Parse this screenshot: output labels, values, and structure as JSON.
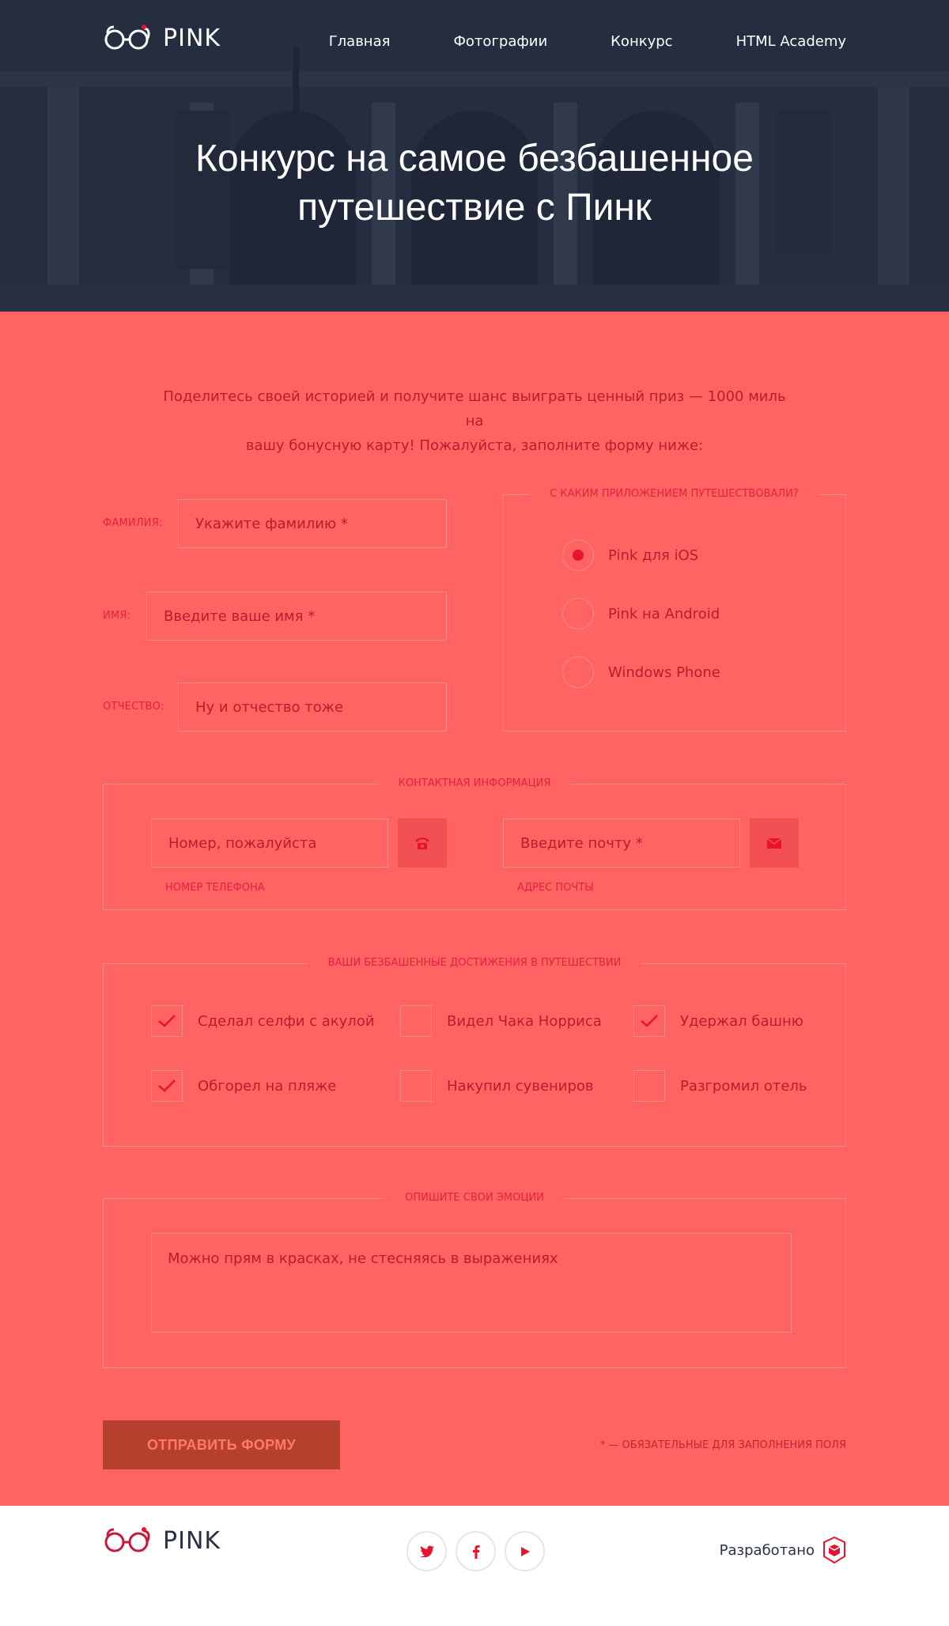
{
  "header": {
    "logo_text": "PINK",
    "nav": [
      {
        "label": "Главная"
      },
      {
        "label": "Фотографии"
      },
      {
        "label": "Конкурс"
      },
      {
        "label": "HTML Academy"
      }
    ],
    "title_line1": "Конкурс на самое безбашенное",
    "title_line2": "путешествие с Пинк"
  },
  "intro": {
    "line1": "Поделитесь своей историей и получите шанс выиграть ценный приз — 1000 миль на",
    "line2": "вашу бонусную карту! Пожалуйста, заполните форму ниже:"
  },
  "name_fields": [
    {
      "label": "Фамилия:",
      "placeholder": "Укажите фамилию *"
    },
    {
      "label": "Имя:",
      "placeholder": "Введите ваше имя *"
    },
    {
      "label": "Отчество:",
      "placeholder": "Ну и отчество тоже"
    }
  ],
  "app_group": {
    "legend": "С каким приложением путешествовали?",
    "options": [
      {
        "label": "Pink для iOS",
        "checked": true
      },
      {
        "label": "Pink на Android",
        "checked": false
      },
      {
        "label": "Windows Phone",
        "checked": false
      }
    ]
  },
  "contact_group": {
    "legend": "Контактная информация",
    "phone_placeholder": "Номер, пожалуйста",
    "phone_label": "Номер телефона",
    "phone_icon": "phone-icon",
    "email_placeholder": "Введите почту *",
    "email_label": "Адрес почты",
    "email_icon": "mail-icon"
  },
  "achievements_group": {
    "legend": "Ваши безбашенные достижения в путешествии",
    "items": [
      {
        "label": "Сделал селфи с акулой",
        "checked": true
      },
      {
        "label": "Видел Чака Норриса",
        "checked": false
      },
      {
        "label": "Удержал башню",
        "checked": true
      },
      {
        "label": "Обгорел на пляже",
        "checked": true
      },
      {
        "label": "Накупил сувениров",
        "checked": false
      },
      {
        "label": "Разгромил отель",
        "checked": false
      }
    ]
  },
  "emotions_group": {
    "legend": "Опишите свои эмоции",
    "placeholder": "Можно прям в красках, не стесняясь в выражениях"
  },
  "submit": {
    "label": "Отправить форму",
    "required_star": "*",
    "required_note": " — обязательные для заполнения поля"
  },
  "footer": {
    "logo_text": "PINK",
    "socials": [
      "twitter-icon",
      "facebook-icon",
      "youtube-icon"
    ],
    "made_by": "Разработано"
  },
  "colors": {
    "form_background": "#ff6462",
    "accent": "#e8132e",
    "submit_background": "#b5402e",
    "footer_background": "#ffffff",
    "header_text": "#ffffff"
  }
}
